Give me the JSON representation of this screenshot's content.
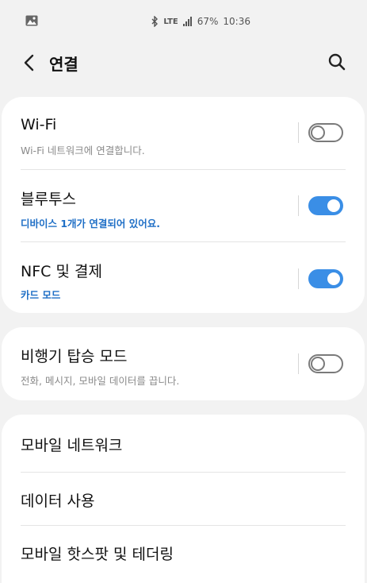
{
  "status": {
    "network": "LTE",
    "battery": "67%",
    "time": "10:36"
  },
  "header": {
    "title": "연결"
  },
  "connections": [
    {
      "label": "Wi-Fi",
      "sub": "Wi-Fi 네트워크에 연결합니다.",
      "enabled": false
    },
    {
      "label": "블루투스",
      "sub": "디바이스 1개가 연결되어 있어요.",
      "enabled": true
    },
    {
      "label": "NFC 및 결제",
      "sub": "카드 모드",
      "enabled": true
    }
  ],
  "airplane": {
    "label": "비행기 탑승 모드",
    "sub": "전화, 메시지, 모바일 데이터를 끕니다.",
    "enabled": false
  },
  "more": [
    {
      "label": "모바일 네트워크"
    },
    {
      "label": "데이터 사용"
    },
    {
      "label": "모바일 핫스팟 및 테더링"
    }
  ],
  "colors": {
    "accent": "#3a8ee6",
    "sub_active": "#1f6fc6"
  }
}
